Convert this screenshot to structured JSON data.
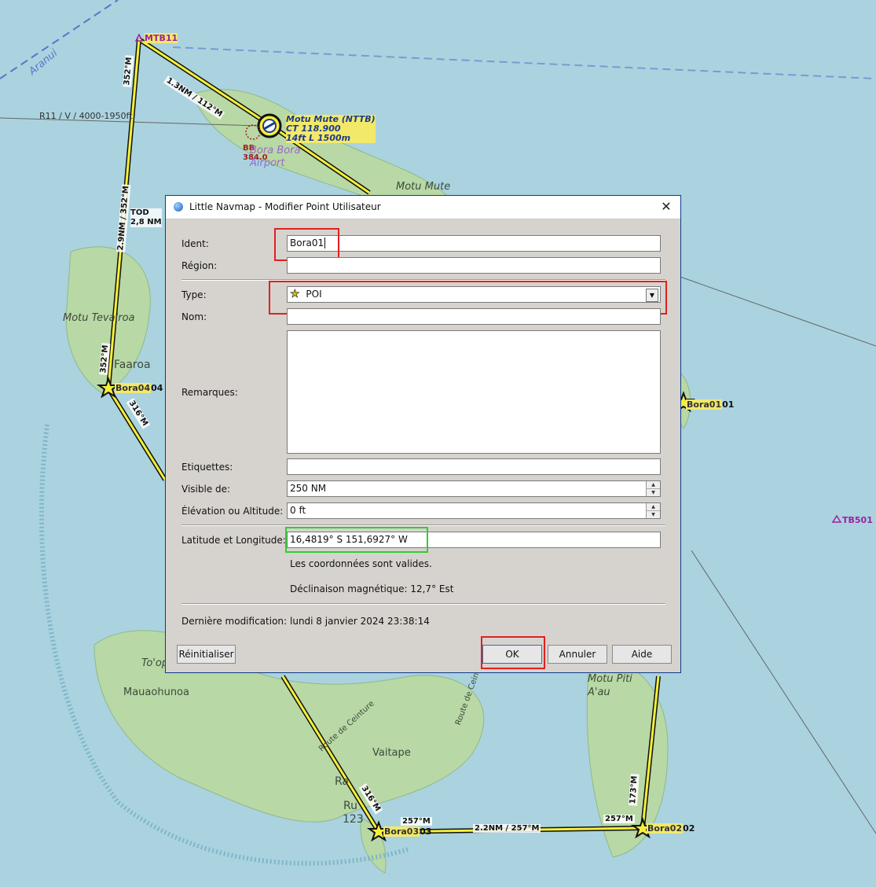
{
  "map": {
    "waypoints": {
      "mtb11": "MTB11",
      "bora01": "Bora01",
      "bora01_suffix": "01",
      "bora02": "Bora02",
      "bora02_suffix": "02",
      "bora03": "Bora03",
      "bora03_suffix": "03",
      "bora04": "Bora04",
      "bora04_suffix": "04",
      "tb501": "TB501",
      "tod": "TOD",
      "tod_dist": "2,8 NM"
    },
    "legs": {
      "mtb11_leg": "1.3NM / 112°M",
      "west_leg_dist": "2.9NM / 352°M",
      "west_course_top": "352°M",
      "west_course_low": "352°M",
      "sw_leg": "316°M",
      "sw_leg_low": "316°M",
      "south_leg": "2.2NM / 257°M",
      "south_course_a": "257°M",
      "south_course_b": "257°M",
      "east_leg": "173°M"
    },
    "airspace": "R11 / V / 4000-1950ft",
    "airport": {
      "name": "Motu Mute (NTTB)",
      "ct": "CT 118.900",
      "runway": "14ft L 1500m",
      "vor_id": "BB",
      "vor_freq": "384.0",
      "label": "Bora Bora Airport"
    },
    "places": {
      "aranui": "Aranui",
      "motu_mute": "Motu Mute",
      "motu_tevairoa": "Motu Tevairoa",
      "faaroa": "Faaroa",
      "toopua": "To'op",
      "mauaohunoa": "Mauaohunoa",
      "vaitape": "Vaitape",
      "motu_piti_aau": "Motu Piti A'au",
      "route_ceinture_1": "Route de Ceinture",
      "route_ceinture_2": "Route de Ceinture",
      "ruata": "Ru",
      "num_123": "123",
      "ra": "Ra"
    }
  },
  "dialog": {
    "title": "Little Navmap - Modifier Point Utilisateur",
    "close": "✕",
    "ident_label": "Ident:",
    "ident_value": "Bora01",
    "region_label": "Région:",
    "region_value": "",
    "type_label": "Type:",
    "type_value": "POI",
    "type_icon": "star-icon",
    "nom_label": "Nom:",
    "nom_value": "",
    "remarques_label": "Remarques:",
    "remarques_value": "",
    "etiquettes_label": "Etiquettes:",
    "etiquettes_value": "",
    "visible_label": "Visible de:",
    "visible_value": "250 NM",
    "elevation_label": "Élévation ou Altitude:",
    "elevation_value": "0 ft",
    "latlon_label": "Latitude et Longitude:",
    "latlon_value": "16,4819° S 151,6927° W",
    "coords_valid": "Les coordonnées sont valides.",
    "declinaison": "Déclinaison magnétique: 12,7° Est",
    "lastmod_label": "Dernière modification:",
    "lastmod_value": "lundi 8 janvier 2024 23:38:14",
    "buttons": {
      "reset": "Réinitialiser",
      "ok": "OK",
      "cancel": "Annuler",
      "help": "Aide"
    }
  },
  "colors": {
    "water": "#aad3df",
    "land": "#b8d8a6",
    "route": "#f5ef3a",
    "highlight_red": "#e02020",
    "highlight_green": "#33cc33"
  }
}
